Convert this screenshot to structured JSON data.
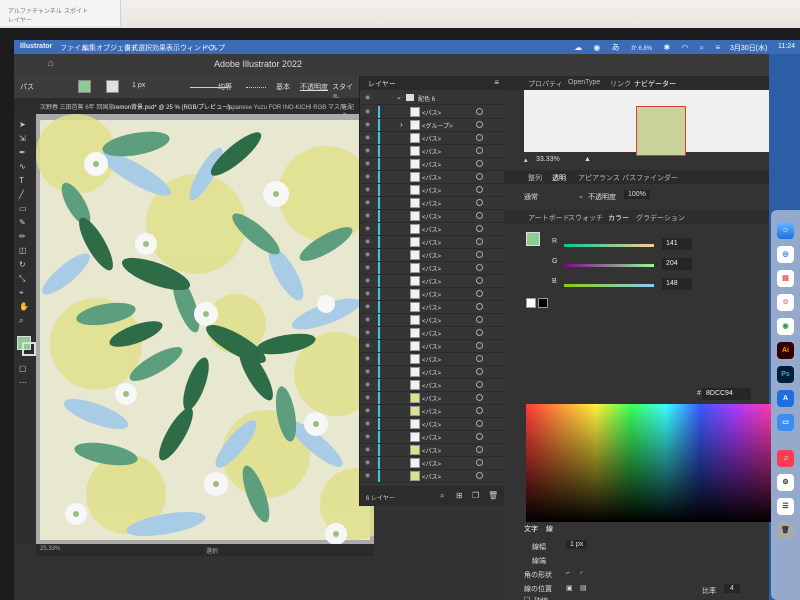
{
  "background_window": {
    "items": [
      "アルファチャンネル",
      "スポイト",
      "レイヤー"
    ]
  },
  "menubar": {
    "app": "Illustrator",
    "items": [
      "ファイル",
      "編集",
      "オブジェクト",
      "書式",
      "選択",
      "効果",
      "表示",
      "ウィンドウ",
      "ヘルプ"
    ],
    "clock_date": "3月30日(水)",
    "clock_time": "11:24",
    "input_method": "か.6.8%"
  },
  "window": {
    "title": "Adobe Illustrator 2022",
    "control_bar": {
      "label": "パス",
      "stroke_weight": "1 px",
      "profile": "均等",
      "brush": "基本",
      "opacity_label": "不透明度",
      "style_label": "スタイル"
    },
    "doc_tabs": [
      "次野春 三田芭蕉 6年 回国旅",
      "remon背景.psd* @ 25 % (RGB/プレビュー)",
      "Japanese Yuzu FOR INO-KICHI RGB マス用",
      "元配色"
    ],
    "status": {
      "zoom": "25.33%",
      "mode": "選択"
    }
  },
  "layers_panel": {
    "tab": "レイヤー",
    "top_layer": "配色 6",
    "group_label": "<グループ>",
    "rows": [
      "<パス>",
      "<グループ>",
      "<パス>",
      "<パス>",
      "<パス>",
      "<パス>",
      "<パス>",
      "<パス>",
      "<パス>",
      "<パス>",
      "<パス>",
      "<パス>",
      "<パス>",
      "<パス>",
      "<パス>",
      "<パス>",
      "<パス>",
      "<パス>",
      "<パス>",
      "<パス>",
      "<パス>",
      "<パス>",
      "<パス>",
      "<パス>",
      "<パス>",
      "<パス>",
      "<パス>",
      "<パス>",
      "<パス>"
    ],
    "footer": "6 レイヤー"
  },
  "right_panel": {
    "top_tabs": [
      "プロパティ",
      "OpenType",
      "リンク",
      "ナビゲーター"
    ],
    "navigator_zoom": "33.33%",
    "mid_tabs": [
      "整列",
      "透明",
      "アピアランス",
      "パスファインダー"
    ],
    "blend_mode": "通常",
    "opacity_label": "不透明度",
    "opacity_value": "100%",
    "color_tabs": [
      "アートボード",
      "スウォッチ",
      "カラー",
      "グラデーション"
    ],
    "color": {
      "r_label": "R",
      "r": "141",
      "g_label": "G",
      "g": "204",
      "b_label": "B",
      "b": "148",
      "hex_prefix": "#",
      "hex": "8DCC94",
      "swatch_color": "#8DCC94"
    },
    "stroke_panel": {
      "tabs": [
        "文字",
        "線"
      ],
      "weight_label": "線幅",
      "weight_value": "1 px",
      "cap_label": "線端",
      "corner_label": "角の形状",
      "align_label": "線の位置",
      "dashed_label": "破線",
      "ratio_label": "比率",
      "ratio_value": "4"
    }
  },
  "dock": {
    "apps": [
      "finder",
      "safari",
      "calendar",
      "photos",
      "chrome",
      "illustrator",
      "photoshop",
      "music",
      "app-store",
      "settings"
    ]
  },
  "colors": {
    "leaf_dark": "#2e6b47",
    "leaf_mid": "#5c9e7e",
    "leaf_light_blue": "#a8cbe6",
    "lemon": "#dfe08b",
    "paper": "#e8e7cf",
    "accent_cyan": "#3cc9e0"
  }
}
